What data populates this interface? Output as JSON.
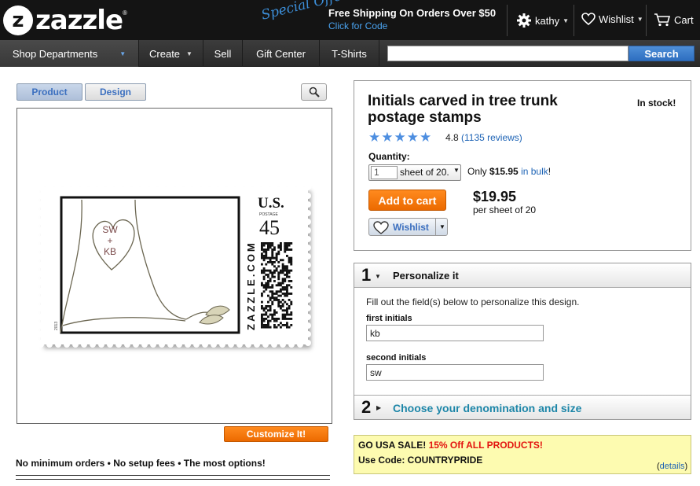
{
  "header": {
    "logo_text": "zazzle",
    "promo_badge": "Special Offer!",
    "promo_title": "Free Shipping On Orders Over $50",
    "promo_link": "Click for Code",
    "user_name": "kathy",
    "wishlist_label": "Wishlist",
    "cart_label": "Cart"
  },
  "nav": {
    "items": [
      {
        "label": "Shop Departments"
      },
      {
        "label": "Create"
      },
      {
        "label": "Sell"
      },
      {
        "label": "Gift Center"
      },
      {
        "label": "T-Shirts"
      }
    ],
    "search_placeholder": "",
    "search_button": "Search"
  },
  "preview": {
    "tab_product": "Product",
    "tab_design": "Design",
    "customize_button": "Customize It!",
    "tagline": "No minimum orders • No setup fees • The most options!",
    "stamp": {
      "country": "U.S.",
      "postage_label": "POSTAGE",
      "denomination": "45",
      "vertical_brand": "ZAZZLE.COM",
      "year": "2013",
      "heart_line1": "SW",
      "heart_line2": "+",
      "heart_line3": "KB"
    }
  },
  "product": {
    "title": "Initials carved in tree trunk postage stamps",
    "stock": "In stock!",
    "rating": "4.8",
    "rating_stars": 4.8,
    "reviews": "(1135 reviews)",
    "quantity_label": "Quantity:",
    "quantity_value": "1",
    "quantity_unit": "sheet of 20.",
    "bulk_prefix": "Only ",
    "bulk_price": "$15.95",
    "bulk_link": "in bulk",
    "bulk_suffix": "!",
    "add_to_cart": "Add to cart",
    "price": "$19.95",
    "price_unit": "per sheet of 20",
    "wishlist_button": "Wishlist"
  },
  "personalize": {
    "step1_number": "1",
    "step1_title": "Personalize it",
    "description": "Fill out the field(s) below to personalize this design.",
    "field1_label": "first initials",
    "field1_value": "kb",
    "field2_label": "second initials",
    "field2_value": "sw",
    "step2_number": "2",
    "step2_title": "Choose your denomination and size"
  },
  "sale": {
    "prefix": "GO USA SALE! ",
    "highlight": "15% Off ALL PRODUCTS!",
    "code_line": "Use Code: COUNTRYPRIDE",
    "details_open": "(",
    "details_link": "details",
    "details_close": ")"
  },
  "colors": {
    "accent_orange": "#ec6a00",
    "link_blue": "#1d63b5",
    "step_teal": "#1d86a8",
    "sale_red": "#e3140f",
    "sale_bg": "#fdfbb0"
  }
}
